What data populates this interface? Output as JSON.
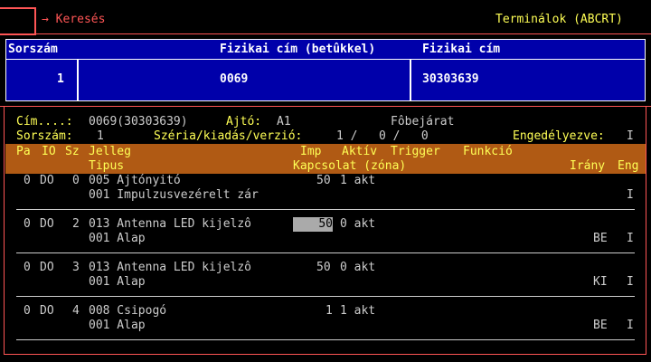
{
  "header": {
    "search_label": "Keresés",
    "title": "Terminálok (ABCRT)"
  },
  "grid": {
    "columns": [
      "Sorszám",
      "Fizikai cím (betûkkel)",
      "Fizikai cím"
    ],
    "row": {
      "sorszam": "1",
      "fizikai_betukkel": "0069",
      "fizikai": "30303639"
    }
  },
  "info": {
    "cim_label": "Cím....:",
    "cim_value": "0069(30303639)",
    "ajto_label": "Ajtó:",
    "ajto_value": "A1",
    "fobejarat": "Fôbejárat",
    "sorszam_label": "Sorszám:",
    "sorszam_value": "1",
    "szeria_label": "Széria/kiadás/verzió:",
    "szeria_value": "1 /   0 /   0",
    "engedelyezve_label": "Engedélyezve:",
    "engedelyezve_value": "I"
  },
  "table_header": {
    "pa": "Pa",
    "io": "IO",
    "sz": "Sz",
    "jelleg": "Jelleg",
    "imp": "Imp",
    "aktiv": "Aktív",
    "trigger": "Trigger",
    "funkcio": "Funkció",
    "tipus": "Tipus",
    "kapcsolat": "Kapcsolat (zóna)",
    "irany": "Irány",
    "eng": "Eng"
  },
  "rows": [
    {
      "pa": "0",
      "io": "DO",
      "sz": "0",
      "jelleg": "005 Ajtónyitó",
      "imp": "50",
      "aktiv": "1 akt",
      "tipus": "001 Impulzusvezérelt zár",
      "irany": "",
      "eng": "I"
    },
    {
      "pa": "0",
      "io": "DO",
      "sz": "2",
      "jelleg": "013 Antenna LED kijelzô",
      "imp": "50",
      "aktiv": "0 akt",
      "tipus": "001 Alap",
      "irany": "BE",
      "eng": "I"
    },
    {
      "pa": "0",
      "io": "DO",
      "sz": "3",
      "jelleg": "013 Antenna LED kijelzô",
      "imp": "50",
      "aktiv": "0 akt",
      "tipus": "001 Alap",
      "irany": "KI",
      "eng": "I"
    },
    {
      "pa": "0",
      "io": "DO",
      "sz": "4",
      "jelleg": "008 Csipogó",
      "imp": "1",
      "aktiv": "1 akt",
      "tipus": "001 Alap",
      "irany": "BE",
      "eng": "I"
    }
  ]
}
